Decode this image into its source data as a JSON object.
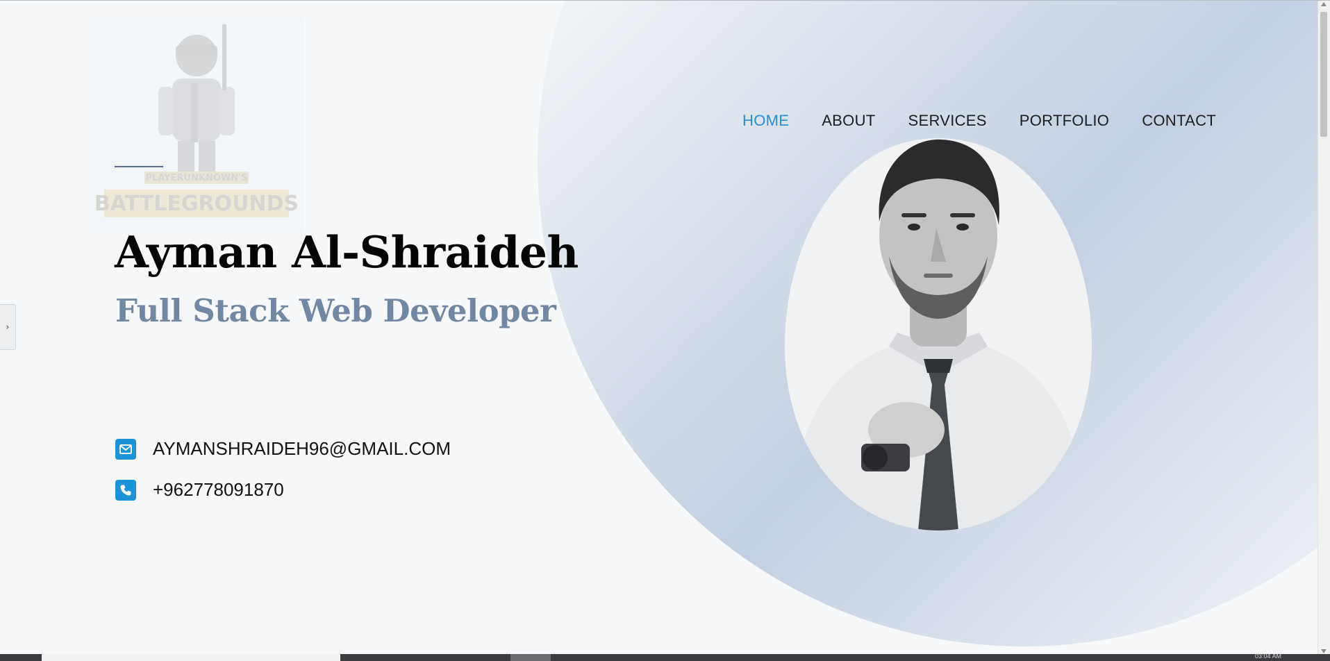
{
  "nav": {
    "items": [
      {
        "label": "HOME",
        "active": true
      },
      {
        "label": "ABOUT",
        "active": false
      },
      {
        "label": "SERVICES",
        "active": false
      },
      {
        "label": "PORTFOLIO",
        "active": false
      },
      {
        "label": "CONTACT",
        "active": false
      }
    ]
  },
  "hero": {
    "name": "Ayman Al-Shraideh",
    "role": "Full Stack Web Developer"
  },
  "logo": {
    "line1": "PLAYERUNKNOWN'S",
    "line2": "BATTLEGROUNDS"
  },
  "contact": {
    "email": "AYMANSHRAIDEH96@GMAIL.COM",
    "phone": "+962778091870"
  },
  "taskbar": {
    "time": "03:04 AM"
  },
  "colors": {
    "accent": "#1b93d8",
    "nav_active": "#2a8fd4",
    "role_text": "#7287a2",
    "background": "#f6f8fa"
  },
  "icons": {
    "email": "envelope-icon",
    "phone": "phone-icon",
    "side_tab": "chevron-right-icon"
  }
}
